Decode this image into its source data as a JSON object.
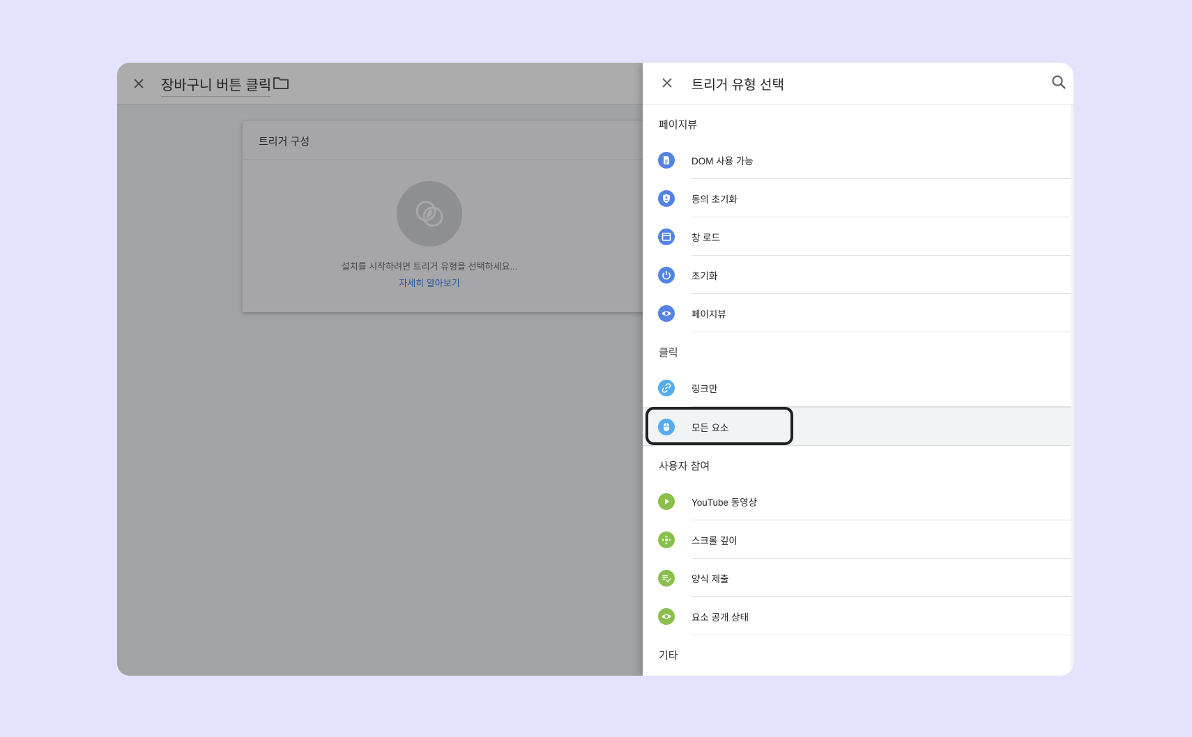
{
  "editor": {
    "title": "장바구니 버튼 클릭",
    "card_title": "트리거 구성",
    "hint": "설치를 시작하려면 트리거 유형을 선택하세요...",
    "learn_more": "자세히 알아보기"
  },
  "panel": {
    "title": "트리거 유형 선택",
    "sections": [
      {
        "title": "페이지뷰",
        "items": [
          "DOM 사용 가능",
          "동의 초기화",
          "창 로드",
          "초기화",
          "페이지뷰"
        ]
      },
      {
        "title": "클릭",
        "items": [
          "링크만",
          "모든 요소"
        ]
      },
      {
        "title": "사용자 참여",
        "items": [
          "YouTube 동영상",
          "스크롤 깊이",
          "양식 제출",
          "요소 공개 상태"
        ]
      },
      {
        "title": "기타"
      }
    ],
    "highlighted_item": "모든 요소"
  },
  "icons": {
    "pageview": [
      "document-icon",
      "shield-icon",
      "window-icon",
      "power-icon",
      "eye-icon"
    ],
    "click": [
      "link-icon",
      "mouse-icon"
    ],
    "engagement": [
      "play-icon",
      "move-icon",
      "form-check-icon",
      "eye-icon"
    ]
  },
  "colors": {
    "background": "#e3e3fd",
    "pageview_icon": "#5483e6",
    "click_icon": "#56acf0",
    "engagement_icon": "#8bbf4c",
    "link": "#2855a3"
  }
}
